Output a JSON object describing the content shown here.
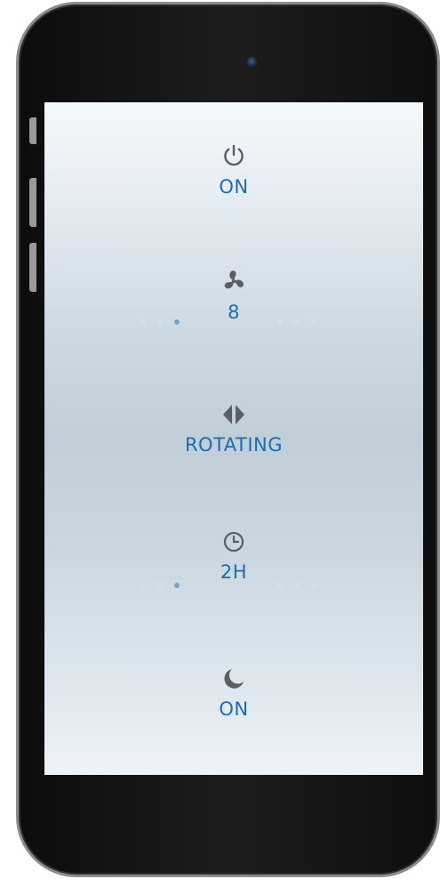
{
  "controls": {
    "power": {
      "icon": "power-icon",
      "value": "ON"
    },
    "fan_speed": {
      "icon": "fan-icon",
      "value": "8",
      "active_dots_left": 1
    },
    "oscillation": {
      "icon": "rotate-arrows-icon",
      "value": "ROTATING"
    },
    "timer": {
      "icon": "clock-icon",
      "value": "2H",
      "active_dots_left": 1
    },
    "night_mode": {
      "icon": "moon-icon",
      "value": "ON"
    }
  },
  "colors": {
    "accent": "#1d6cb2",
    "icon": "#5a5f66",
    "dot_active": "#6fa6d7",
    "dot_inactive": "#cfe0ee"
  }
}
